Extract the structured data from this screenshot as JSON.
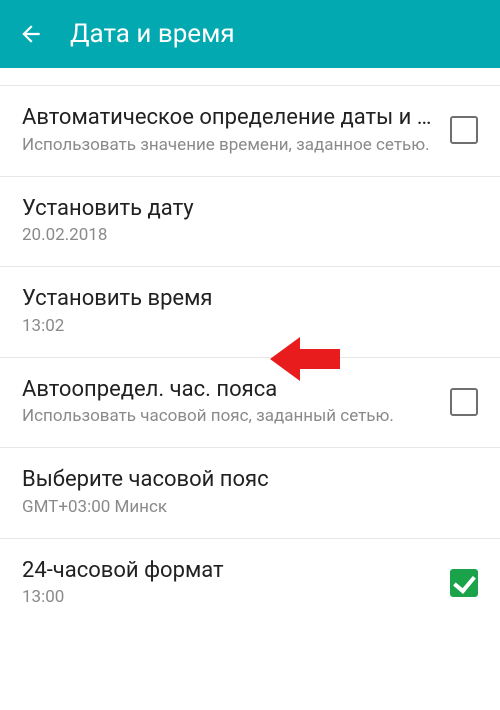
{
  "appbar": {
    "title": "Дата и время"
  },
  "rows": {
    "auto_datetime": {
      "title": "Автоматическое определение даты и времени",
      "subtitle": "Использовать значение времени, заданное сетью.",
      "checked": false
    },
    "set_date": {
      "title": "Установить дату",
      "subtitle": "20.02.2018"
    },
    "set_time": {
      "title": "Установить время",
      "subtitle": "13:02"
    },
    "auto_tz": {
      "title": "Автоопредел. час. пояса",
      "subtitle": "Использовать часовой пояс, заданный сетью.",
      "checked": false
    },
    "select_tz": {
      "title": "Выберите часовой пояс",
      "subtitle": "GMT+03:00 Минск"
    },
    "format24": {
      "title": "24-часовой формат",
      "subtitle": "13:00",
      "checked": true
    }
  }
}
